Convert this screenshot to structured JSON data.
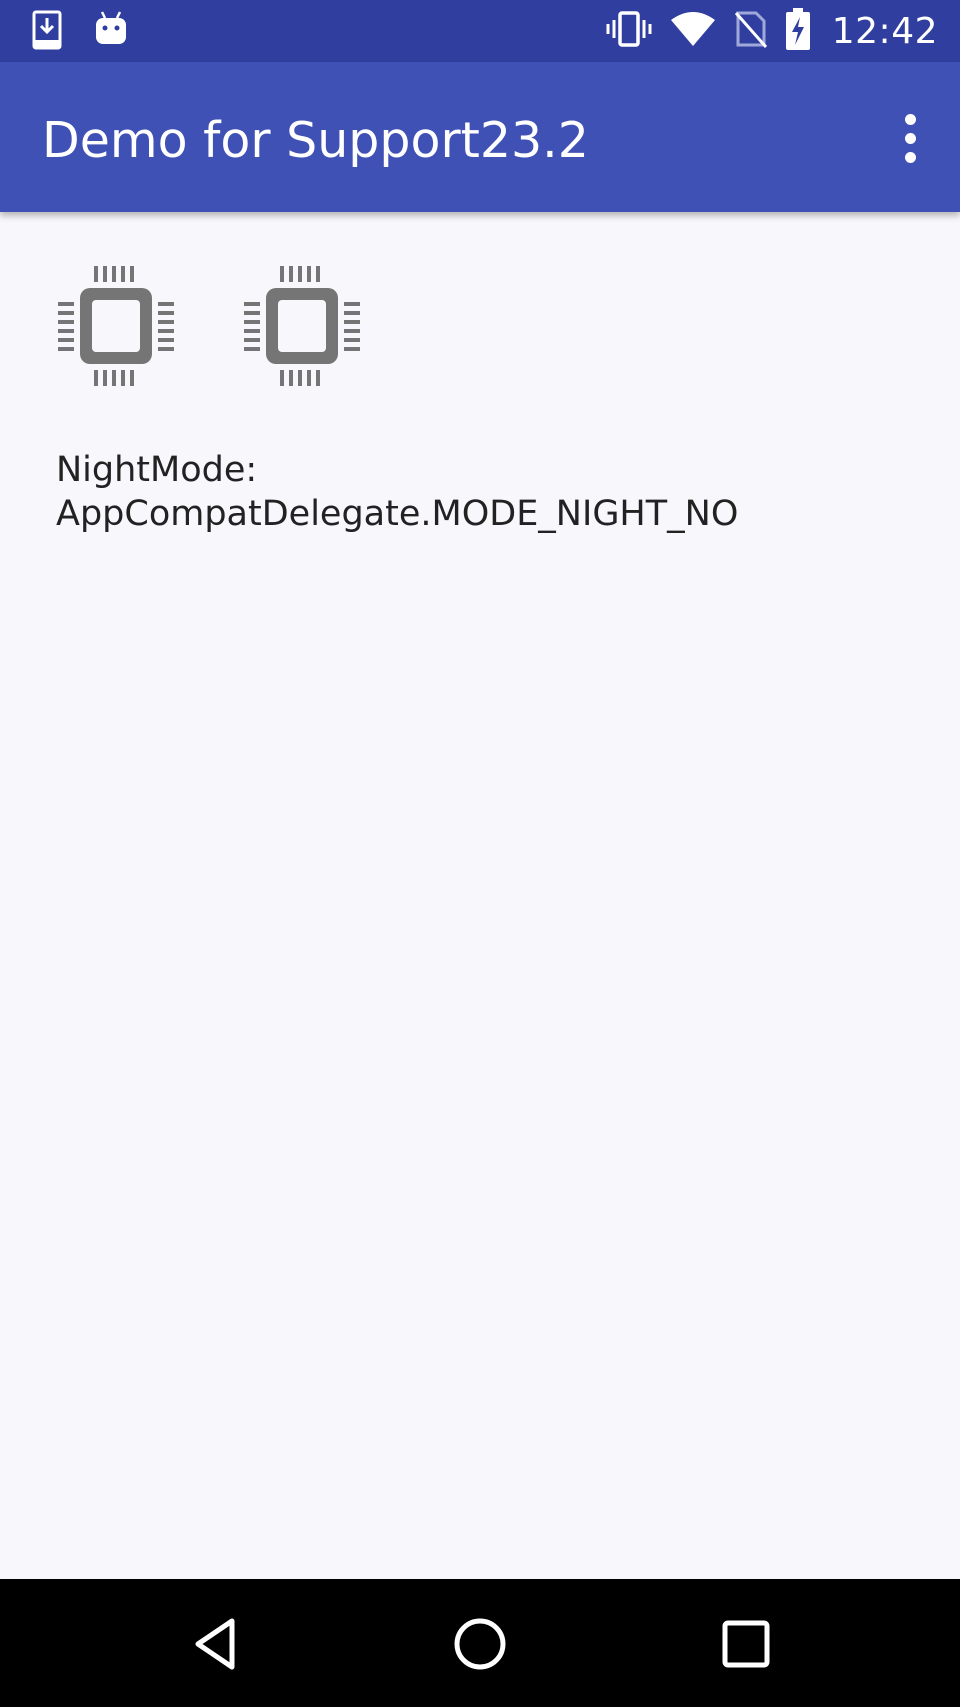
{
  "status_bar": {
    "time": "12:42",
    "left_icons": [
      "download-notification-icon",
      "android-debug-icon"
    ],
    "right_icons": [
      "vibrate-icon",
      "wifi-icon",
      "no-sim-icon",
      "battery-charging-icon"
    ]
  },
  "app_bar": {
    "title": "Demo for Support23.2",
    "overflow_icon": "more-vert-icon"
  },
  "content": {
    "icons": [
      "memory-chip-icon",
      "memory-chip-icon"
    ],
    "night_mode_label": "NightMode:",
    "night_mode_value": "AppCompatDelegate.MODE_NIGHT_NO"
  },
  "nav_bar": {
    "buttons": [
      "back-icon",
      "home-icon",
      "recents-icon"
    ]
  },
  "colors": {
    "status_bar": "#303f9f",
    "app_bar": "#3f51b5",
    "background": "#f8f7fb",
    "chip_icon": "#757575",
    "nav_bar": "#000000"
  }
}
